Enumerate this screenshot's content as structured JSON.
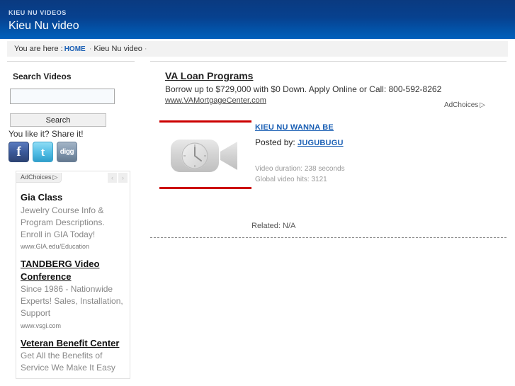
{
  "header": {
    "brand_small": "KIEU NU VIDEOS",
    "brand_main": "Kieu Nu video"
  },
  "breadcrumb": {
    "label": "You are here :",
    "home": "HOME",
    "separator": "·",
    "current": "Kieu Nu video",
    "trailing": "·"
  },
  "sidebar": {
    "search_heading": "Search Videos",
    "search_value": "",
    "search_placeholder": "",
    "search_button": "Search",
    "share_text": "You like it? Share it!",
    "social": [
      {
        "name": "facebook",
        "glyph": "f"
      },
      {
        "name": "twitter",
        "glyph": "t"
      },
      {
        "name": "digg",
        "glyph": "digg"
      }
    ],
    "ad_box": {
      "adchoices_label": "AdChoices",
      "adchoices_mark": "▷",
      "prev": "‹",
      "next": "›",
      "ads": [
        {
          "title": "Gia Class",
          "title_underlined": false,
          "desc": "Jewelry Course Info & Program Descriptions. Enroll in GIA Today!",
          "url": "www.GIA.edu/Education"
        },
        {
          "title": "TANDBERG Video Conference",
          "title_underlined": true,
          "desc": "Since 1986 - Nationwide Experts! Sales, Installation, Support",
          "url": "www.vsgi.com"
        },
        {
          "title": "Veteran Benefit Center",
          "title_underlined": true,
          "desc": "Get All the Benefits of Service We Make It Easy",
          "url": ""
        }
      ]
    }
  },
  "main": {
    "top_ad": {
      "title": "VA Loan Programs",
      "desc": "Borrow up to $729,000 with $0 Down. Apply Online or Call: 800-592-8262",
      "url": "www.VAMortgageCenter.com",
      "adchoices_label": "AdChoices",
      "adchoices_mark": "▷"
    },
    "video": {
      "thumb_icon": "video-camera-clock-placeholder",
      "title": "KIEU NU WANNA BE",
      "posted_by_label": "Posted by:",
      "posted_by_name": "JUGUBUGU",
      "duration": "Video duration: 238 seconds",
      "hits": "Global video hits: 3121"
    },
    "related": "Related: N/A"
  },
  "colors": {
    "header_top": "#0a3a80",
    "header_bottom": "#0068c4",
    "link_blue": "#1a5fb4",
    "rule_red": "#cc0000",
    "breadcrumb_bg": "#f2f2f2"
  }
}
